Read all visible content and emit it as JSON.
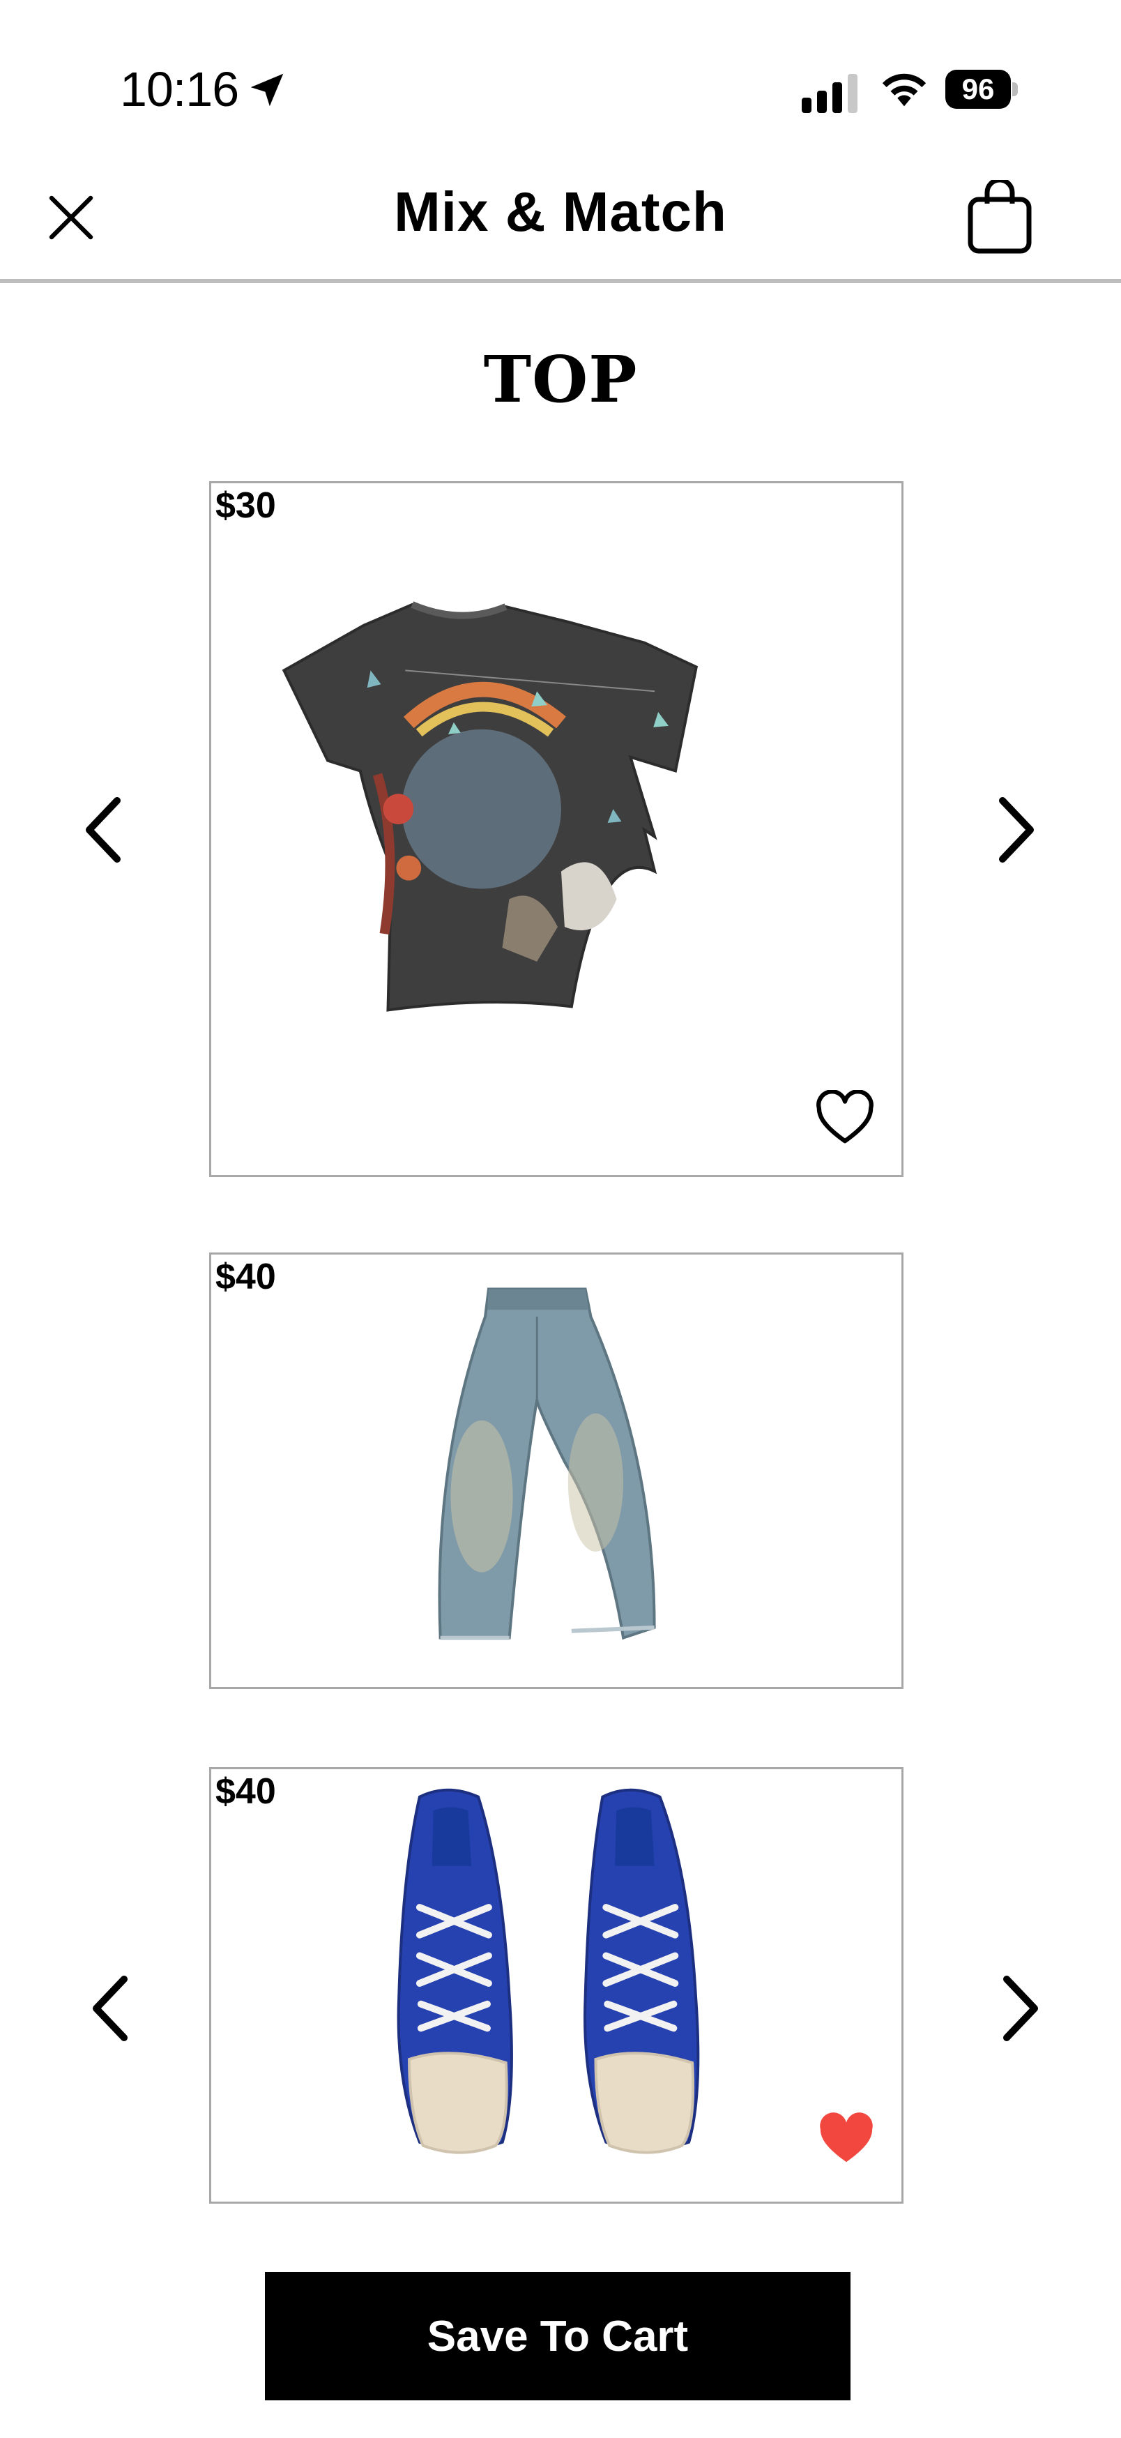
{
  "status_bar": {
    "time": "10:16",
    "battery": "96"
  },
  "header": {
    "title": "Mix & Match"
  },
  "section": {
    "title": "TOP"
  },
  "products": {
    "top": {
      "price": "$30",
      "favorited": false
    },
    "bottom": {
      "price": "$40"
    },
    "shoes": {
      "price": "$40",
      "favorited": true
    }
  },
  "actions": {
    "save_label": "Save To Cart"
  },
  "colors": {
    "accent": "#f2473f",
    "button_bg": "#000000",
    "divider": "#bdbdbd"
  },
  "icons": [
    "close-icon",
    "shopping-bag-icon",
    "chevron-left-icon",
    "chevron-right-icon",
    "heart-outline-icon",
    "heart-filled-icon",
    "location-arrow-icon",
    "signal-icon",
    "wifi-icon",
    "battery-icon"
  ]
}
